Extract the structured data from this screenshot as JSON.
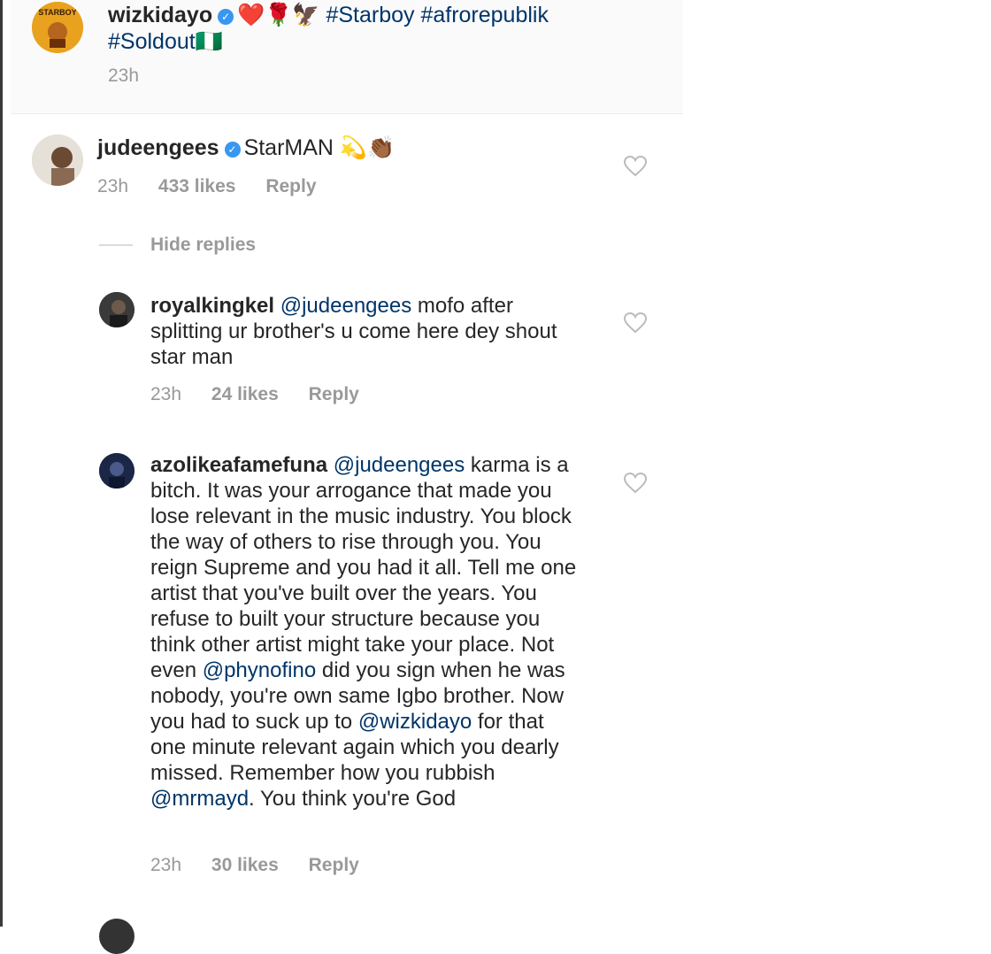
{
  "post": {
    "username": "wizkidayo",
    "caption_emojis": "❤️🌹🦅",
    "hashtags_line1": "#Starboy #afrorepublik",
    "hashtags_line2": "#Soldout",
    "flag": "🇳🇬",
    "time": "23h",
    "avatar_color": "#e8a21f"
  },
  "comments": [
    {
      "username": "judeengees",
      "text": "StarMAN",
      "emojis": "💫👏🏾",
      "time": "23h",
      "likes": "433 likes",
      "reply_label": "Reply",
      "hide_replies": "Hide replies"
    }
  ],
  "replies": [
    {
      "username": "royalkingkel",
      "mention": "@judeengees",
      "text": "mofo after splitting ur brother's u come here dey shout star man",
      "time": "23h",
      "likes": "24 likes",
      "reply_label": "Reply"
    },
    {
      "username": "azolikeafamefuna",
      "mention": "@judeengees",
      "text_part1": "karma is a bitch. It was your arrogance that made you lose relevant in the music industry. You block the way of others to rise through you. You reign Supreme and you had it all. Tell me one artist that you've built over the years. You refuse to built your structure because you think other artist might take your place. Not even",
      "mention2": "@phynofino",
      "text_part2": "did you sign when he was nobody, you're own same Igbo brother. Now you had to suck up to",
      "mention3": "@wizkidayo",
      "text_part3": "for that one minute relevant again which you dearly missed. Remember how you rubbish",
      "mention4": "@mrmayd",
      "text_part4": ". You think you're God",
      "time": "23h",
      "likes": "30 likes",
      "reply_label": "Reply"
    }
  ],
  "colors": {
    "link": "#003569",
    "meta": "#999999",
    "verified": "#3897f0"
  }
}
